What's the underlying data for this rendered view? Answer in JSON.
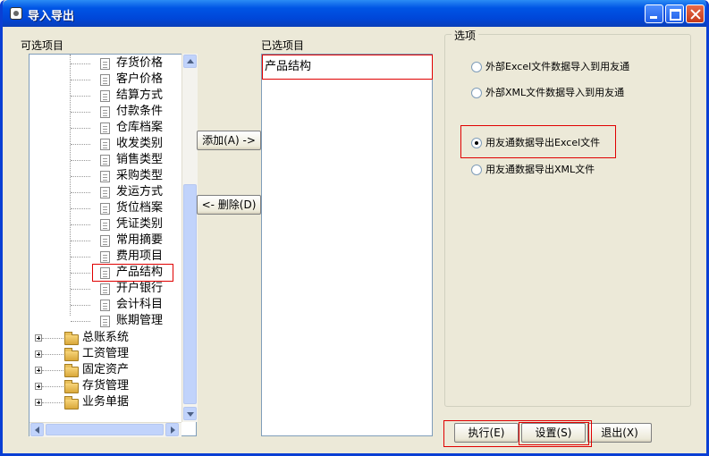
{
  "window": {
    "title": "导入导出"
  },
  "left_panel": {
    "label": "可选项目",
    "leaf_items": [
      "存货价格",
      "客户价格",
      "结算方式",
      "付款条件",
      "仓库档案",
      "收发类别",
      "销售类型",
      "采购类型",
      "发运方式",
      "货位档案",
      "凭证类别",
      "常用摘要",
      "费用项目",
      "产品结构",
      "开户银行",
      "会计科目",
      "账期管理"
    ],
    "folder_items": [
      "总账系统",
      "工资管理",
      "固定资产",
      "存货管理",
      "业务单据"
    ],
    "highlighted_item": "产品结构"
  },
  "middle_buttons": {
    "add": "添加(A) ->",
    "delete": "<- 删除(D)"
  },
  "right_panel": {
    "label": "已选项目",
    "selected_items": [
      "产品结构"
    ]
  },
  "options": {
    "title": "选项",
    "radios": [
      {
        "label": "外部Excel文件数据导入到用友通",
        "checked": false
      },
      {
        "label": "外部XML文件数据导入到用友通",
        "checked": false
      },
      {
        "label": "用友通数据导出Excel文件",
        "checked": true
      },
      {
        "label": "用友通数据导出XML文件",
        "checked": false
      }
    ]
  },
  "footer_buttons": {
    "execute": "执行(E)",
    "settings": "设置(S)",
    "exit": "退出(X)"
  },
  "icons": {
    "leaf": "document-icon",
    "folder": "folder-icon",
    "expand": "plus-expand-icon"
  },
  "colors": {
    "titlebar": "#0055e5",
    "highlight_border": "#e00000",
    "window_bg": "#ece9d8"
  }
}
